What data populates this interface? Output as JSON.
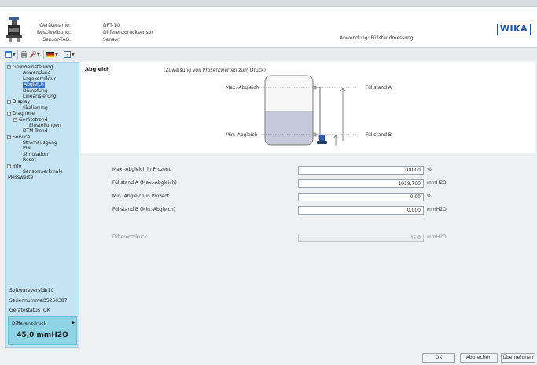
{
  "header": {
    "device_labels": [
      "Gerätename:",
      "Beschreibung:",
      "Sensor-TAG:"
    ],
    "device_values": [
      "DPT-10",
      "Differenzdrucksensor",
      "Sensor"
    ],
    "application": "Anwendung: Füllstandmessung",
    "brand": "WIKA"
  },
  "toolbar": {
    "icons": [
      "view-icon",
      "print-icon",
      "tools-icon",
      "flag-icon",
      "help-icon"
    ]
  },
  "sidebar": {
    "tree": [
      {
        "label": "Grundeinstellung",
        "level": 0,
        "expander": "−"
      },
      {
        "label": "Anwendung",
        "level": 2
      },
      {
        "label": "Lagekorrektur",
        "level": 2
      },
      {
        "label": "Abgleich",
        "level": 2,
        "selected": true
      },
      {
        "label": "Dämpfung",
        "level": 2
      },
      {
        "label": "Linearisierung",
        "level": 2
      },
      {
        "label": "Display",
        "level": 0,
        "expander": "−"
      },
      {
        "label": "Skalierung",
        "level": 2
      },
      {
        "label": "Diagnose",
        "level": 0,
        "expander": "−"
      },
      {
        "label": "Gerätetrend",
        "level": 1,
        "expander": "−"
      },
      {
        "label": "Einstellungen",
        "level": 3
      },
      {
        "label": "DTM-Trend",
        "level": 2
      },
      {
        "label": "Service",
        "level": 0,
        "expander": "−"
      },
      {
        "label": "Stromausgang",
        "level": 2
      },
      {
        "label": "PIN",
        "level": 2
      },
      {
        "label": "Simulation",
        "level": 2
      },
      {
        "label": "Reset",
        "level": 2
      },
      {
        "label": "Info",
        "level": 0,
        "expander": "−"
      },
      {
        "label": "Sensormerkmale",
        "level": 2
      },
      {
        "label": "Messwerte",
        "level": 0
      }
    ],
    "info": [
      {
        "key": "Softwareversion",
        "value": "1.10"
      },
      {
        "key": "Seriennummer",
        "value": "35250387"
      },
      {
        "key": "Gerätestatus",
        "value": "OK"
      }
    ],
    "dp_label": "Differenzdruck",
    "dp_value": "45,0 mmH2O"
  },
  "main": {
    "title": "Abgleich",
    "subtitle": "(Zuweisung von Prozentwerten zum Druck)",
    "diagram": {
      "max_label": "Max.-Abgleich",
      "min_label": "Min.-Abgleich",
      "level_a": "Füllstand A",
      "level_b": "Füllstand B"
    },
    "fields": [
      {
        "label": "Max.-Abgleich in Prozent",
        "value": "100,00",
        "unit": "%"
      },
      {
        "label": "Füllstand A (Max.-Abgleich)",
        "value": "1019,700",
        "unit": "mmH2O"
      },
      {
        "label": "Min.-Abgleich in Prozent",
        "value": "0,00",
        "unit": "%"
      },
      {
        "label": "Füllstand B (Min.-Abgleich)",
        "value": "0,000",
        "unit": "mmH2O"
      }
    ],
    "diff": {
      "label": "Differenzdruck",
      "value": "45,0",
      "unit": "mmH2O"
    }
  },
  "buttons": {
    "ok": "OK",
    "cancel": "Abbrechen",
    "apply": "Übernehmen"
  }
}
